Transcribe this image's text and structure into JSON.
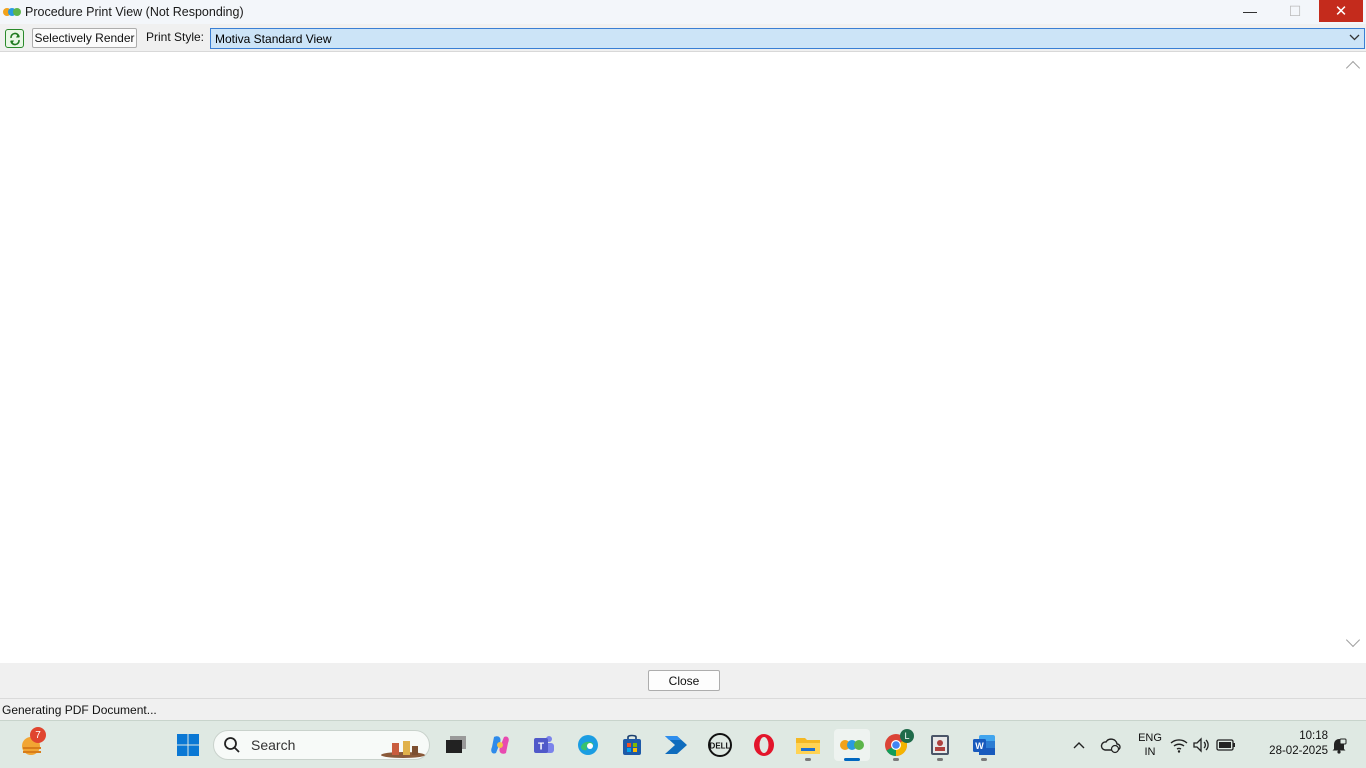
{
  "window": {
    "title": "Procedure Print View (Not Responding)",
    "minimize_glyph": "—",
    "maximize_glyph": "☐",
    "close_glyph": "✕"
  },
  "toolbar": {
    "selectively_render_label": "Selectively Render",
    "print_style_label": "Print Style:",
    "print_style_value": "Motiva Standard View"
  },
  "footer": {
    "close_label": "Close"
  },
  "status": {
    "text": "Generating PDF Document..."
  },
  "taskbar": {
    "weather_badge": "7",
    "search_label": "Search",
    "chrome_badge": "L",
    "language_top": "ENG",
    "language_bottom": "IN",
    "time": "10:18",
    "date": "28-02-2025"
  },
  "colors": {
    "close_button": "#c42b1c",
    "select_highlight": "#cce4f7",
    "select_border": "#3a7fd4",
    "taskbar": "#dfe9e3",
    "active_indicator": "#0067c0"
  }
}
